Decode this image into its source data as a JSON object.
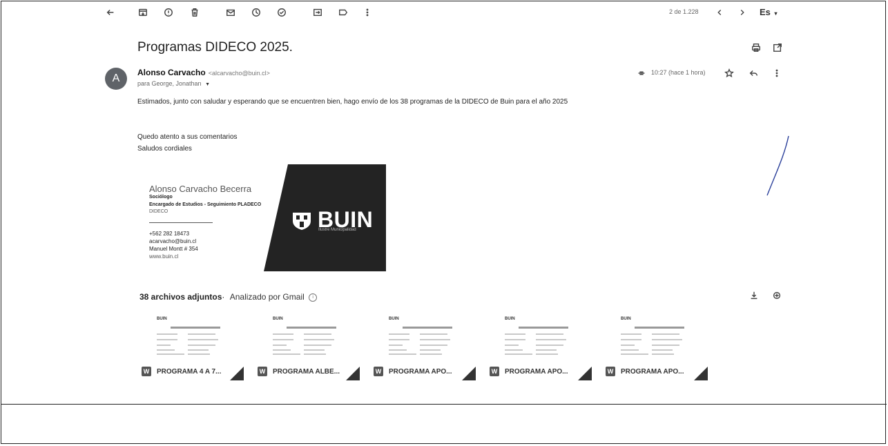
{
  "toolbar": {
    "icons": [
      "back-arrow-icon",
      "archive-icon",
      "report-spam-icon",
      "trash-icon",
      "mark-unread-icon",
      "snooze-icon",
      "add-task-icon",
      "move-to-icon",
      "label-icon",
      "more-vert-icon"
    ],
    "pagination": "2 de 1.228",
    "language": "Es"
  },
  "email": {
    "subject": "Programas DIDECO 2025.",
    "avatar_letter": "A",
    "sender_name": "Alonso Carvacho",
    "sender_email": "<alcarvacho@buin.cl>",
    "recipients": "para George, Jonathan",
    "time": "10:27 (hace 1 hora)",
    "body": [
      "Estimados, junto con saludar y esperando que se encuentren bien, hago envío de los 38 programas de la DIDECO de Buin para el año 2025",
      "Quedo atento a sus comentarios",
      "Saludos cordiales"
    ]
  },
  "signature": {
    "name": "Alonso Carvacho Becerra",
    "role": "Sociólogo",
    "position": "Encargado de Estudios - Seguimiento PLADECO",
    "department": "DIDECO",
    "phone": "+562 282 18473",
    "email": "acarvacho@buin.cl",
    "address": "Manuel Montt # 354",
    "web": "www.buin.cl",
    "logo_text": "BUIN",
    "logo_sub": "Ilustre Municipalidad"
  },
  "attachments": {
    "title": "38 archivos adjuntos",
    "separator": "·",
    "scanned": "Analizado por Gmail",
    "files": [
      {
        "label": "PROGRAMA 4 A 7...",
        "thumb_logo": "BUIN"
      },
      {
        "label": "PROGRAMA ALBE...",
        "thumb_logo": "BUIN"
      },
      {
        "label": "PROGRAMA APO...",
        "thumb_logo": "BUIN"
      },
      {
        "label": "PROGRAMA APO...",
        "thumb_logo": "BUIN"
      },
      {
        "label": "PROGRAMA APO...",
        "thumb_logo": "BUIN"
      }
    ]
  }
}
